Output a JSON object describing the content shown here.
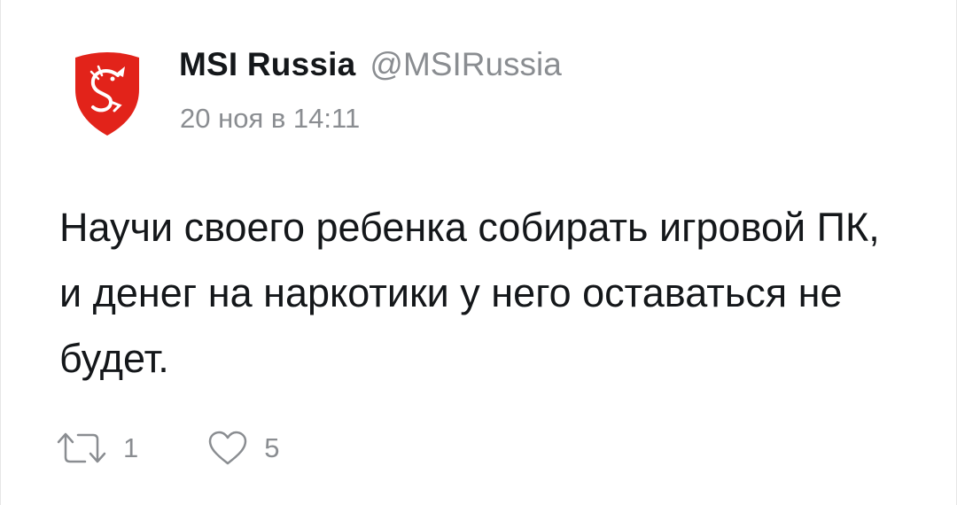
{
  "tweet": {
    "author": {
      "display_name": "MSI Russia",
      "handle": "@MSIRussia",
      "avatar_icon": "msi-dragon-shield-logo"
    },
    "timestamp": "20 ноя в 14:11",
    "text": "Научи своего ребенка собирать игровой ПК, и денег на наркотики у него оставаться не будет.",
    "actions": {
      "retweet_icon": "retweet-icon",
      "retweet_count": "1",
      "like_icon": "heart-outline-icon",
      "like_count": "5"
    }
  },
  "colors": {
    "text_primary": "#14171a",
    "text_secondary": "#8a8d91",
    "brand_red": "#e2231a",
    "background": "#ffffff"
  }
}
